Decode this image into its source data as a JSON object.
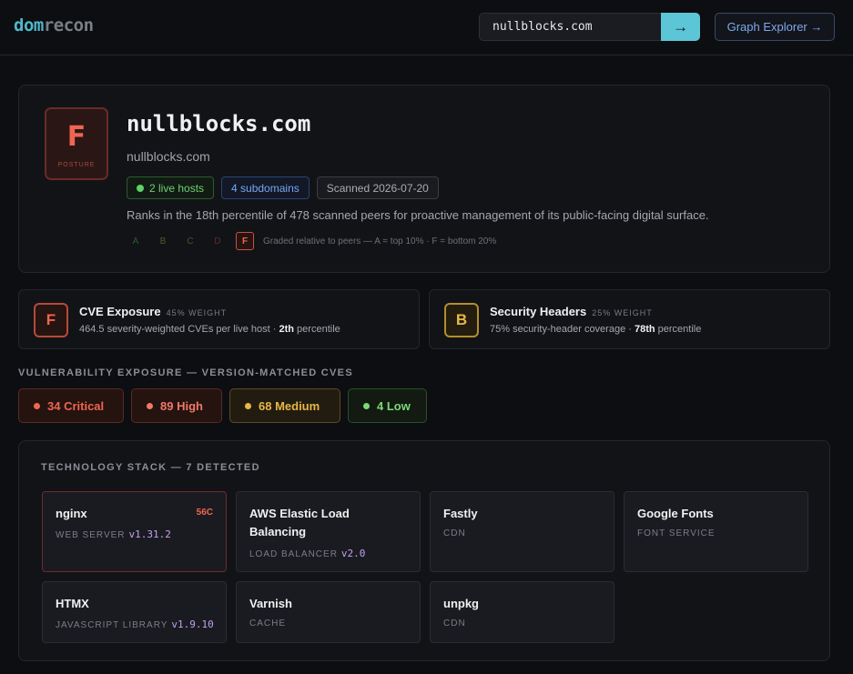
{
  "header": {
    "logo_a": "dom",
    "logo_b": "recon",
    "search_value": "nullblocks.com",
    "go_label": "→",
    "graph_button": "Graph Explorer →"
  },
  "hero": {
    "grade": "F",
    "grade_label": "POSTURE",
    "domain": "nullblocks.com",
    "sub_domain": "nullblocks.com",
    "pills": {
      "live_hosts": "2 live hosts",
      "subdomains": "4 subdomains",
      "scanned": "Scanned 2026-07-20"
    },
    "description": "Ranks in the 18th percentile of 478 scanned peers for proactive management of its public-facing digital surface.",
    "scale": [
      "A",
      "B",
      "C",
      "D",
      "F"
    ],
    "scale_note": "Graded relative to peers — A = top 10% · F = bottom 20%"
  },
  "metrics": [
    {
      "grade": "F",
      "title": "CVE Exposure",
      "weight": "45% WEIGHT",
      "desc_pre": "464.5 severity-weighted CVEs per live host · ",
      "desc_bold": "2th",
      "desc_post": " percentile"
    },
    {
      "grade": "B",
      "title": "Security Headers",
      "weight": "25% WEIGHT",
      "desc_pre": "75% security-header coverage · ",
      "desc_bold": "78th",
      "desc_post": " percentile"
    }
  ],
  "vuln": {
    "label": "VULNERABILITY EXPOSURE — VERSION-MATCHED CVES",
    "critical": "34 Critical",
    "high": "89 High",
    "medium": "68 Medium",
    "low": "4 Low"
  },
  "stack": {
    "title": "TECHNOLOGY STACK — 7 DETECTED",
    "items": [
      {
        "name": "nginx",
        "category": "WEB SERVER",
        "version": "v1.31.2",
        "cves": "56C"
      },
      {
        "name": "AWS Elastic Load Balancing",
        "category": "LOAD BALANCER",
        "version": "v2.0"
      },
      {
        "name": "Fastly",
        "category": "CDN"
      },
      {
        "name": "Google Fonts",
        "category": "FONT SERVICE"
      },
      {
        "name": "HTMX",
        "category": "JAVASCRIPT LIBRARY",
        "version": "v1.9.10"
      },
      {
        "name": "Varnish",
        "category": "CACHE"
      },
      {
        "name": "unpkg",
        "category": "CDN"
      }
    ]
  },
  "colors": {
    "accent": "#5cc6d6",
    "critical": "#ef6650",
    "medium": "#e8b64a",
    "low": "#7dd876",
    "link": "#7fa8ea"
  }
}
